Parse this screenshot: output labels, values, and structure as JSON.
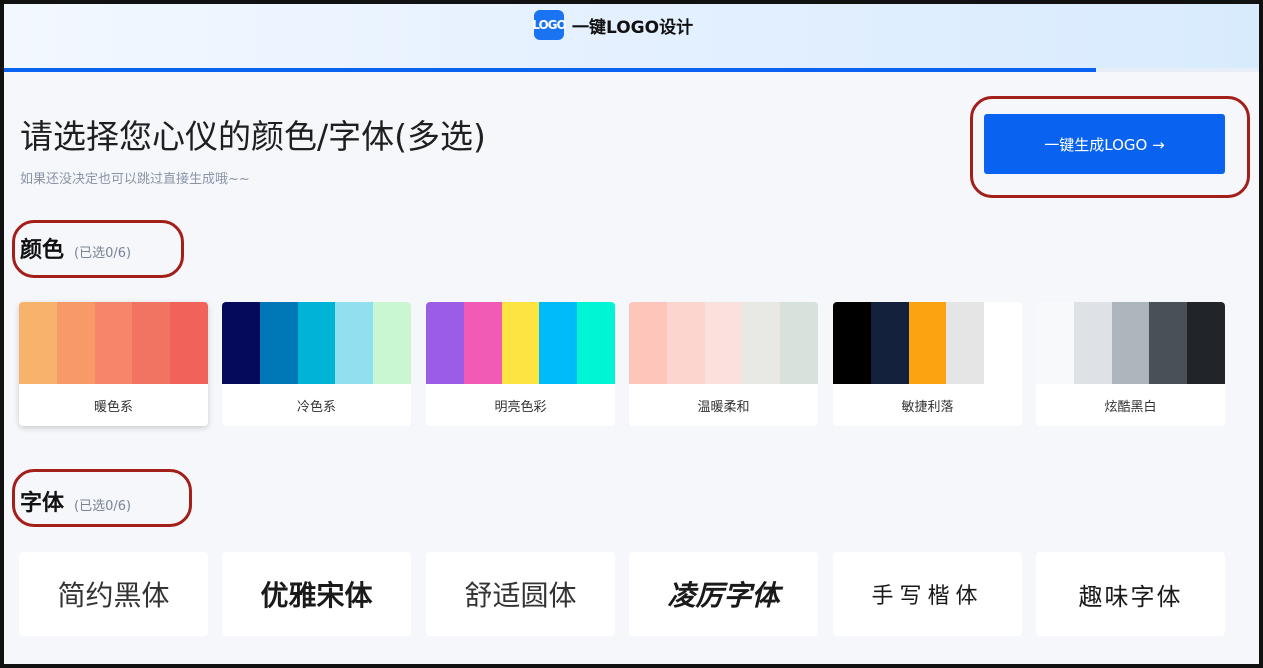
{
  "header": {
    "logo_text": "LOGO",
    "app_name": "一键LOGO设计",
    "progress_fraction": 0.87
  },
  "page": {
    "title": "请选择您心仪的颜色/字体(多选)",
    "subtitle": "如果还没决定也可以跳过直接生成哦~~",
    "generate_button": "一键生成LOGO →"
  },
  "colors_section": {
    "title": "颜色",
    "count": "(已选0/6)",
    "palettes": [
      {
        "label": "暖色系",
        "colors": [
          "#f7b26c",
          "#f89a68",
          "#f5866a",
          "#f17462",
          "#f0625a"
        ]
      },
      {
        "label": "冷色系",
        "colors": [
          "#050a5a",
          "#0077b6",
          "#00b4d8",
          "#90e0ef",
          "#c8f7d2"
        ]
      },
      {
        "label": "明亮色彩",
        "colors": [
          "#9b5de5",
          "#f15bb5",
          "#fee440",
          "#00bbf9",
          "#00f5d4"
        ]
      },
      {
        "label": "温暖柔和",
        "colors": [
          "#fec5bb",
          "#fcd5ce",
          "#fae1dd",
          "#e8e8e4",
          "#d8e2dc"
        ]
      },
      {
        "label": "敏捷利落",
        "colors": [
          "#000000",
          "#14213d",
          "#fca311",
          "#e5e5e5",
          "#ffffff"
        ]
      },
      {
        "label": "炫酷黑白",
        "colors": [
          "#f8f9fa",
          "#dee2e6",
          "#adb5bd",
          "#495057",
          "#212529"
        ]
      }
    ]
  },
  "fonts_section": {
    "title": "字体",
    "count": "(已选0/6)",
    "fonts": [
      {
        "label": "简约黑体"
      },
      {
        "label": "优雅宋体"
      },
      {
        "label": "舒适圆体"
      },
      {
        "label": "凌厉字体"
      },
      {
        "label": "手写楷体"
      },
      {
        "label": "趣味字体"
      }
    ]
  }
}
